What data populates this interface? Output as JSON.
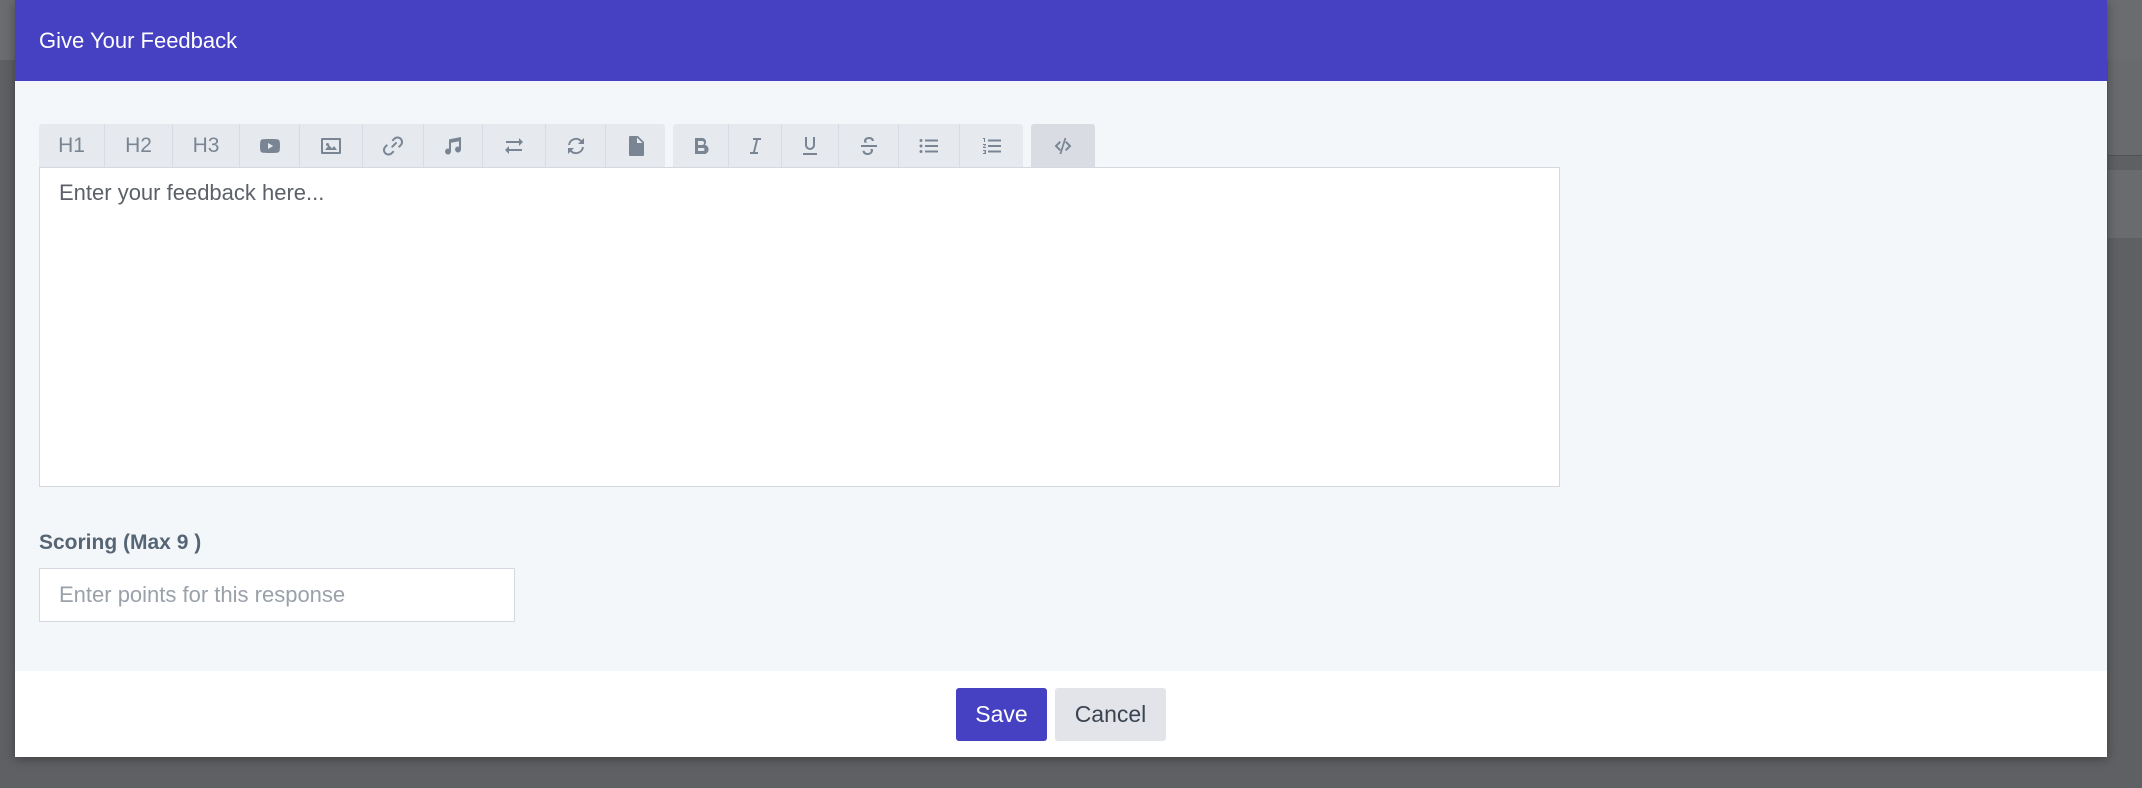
{
  "modal": {
    "title": "Give Your Feedback"
  },
  "toolbar": {
    "headings": [
      "H1",
      "H2",
      "H3"
    ],
    "media_icons": [
      "youtube-icon",
      "image-icon",
      "link-icon",
      "music-icon",
      "swap-icon",
      "refresh-icon",
      "file-icon"
    ],
    "format_icons": [
      "bold-icon",
      "italic-icon",
      "underline-icon",
      "strikethrough-icon",
      "bullet-list-icon",
      "numbered-list-icon"
    ],
    "code_icon": "code-icon"
  },
  "editor": {
    "placeholder": "Enter your feedback here..."
  },
  "scoring": {
    "label": "Scoring (Max 9 )",
    "placeholder": "Enter points for this response"
  },
  "footer": {
    "save_label": "Save",
    "cancel_label": "Cancel"
  },
  "colors": {
    "accent": "#4640c2",
    "body_bg": "#f4f7fa",
    "toolbar_bg": "#e6eaef"
  }
}
